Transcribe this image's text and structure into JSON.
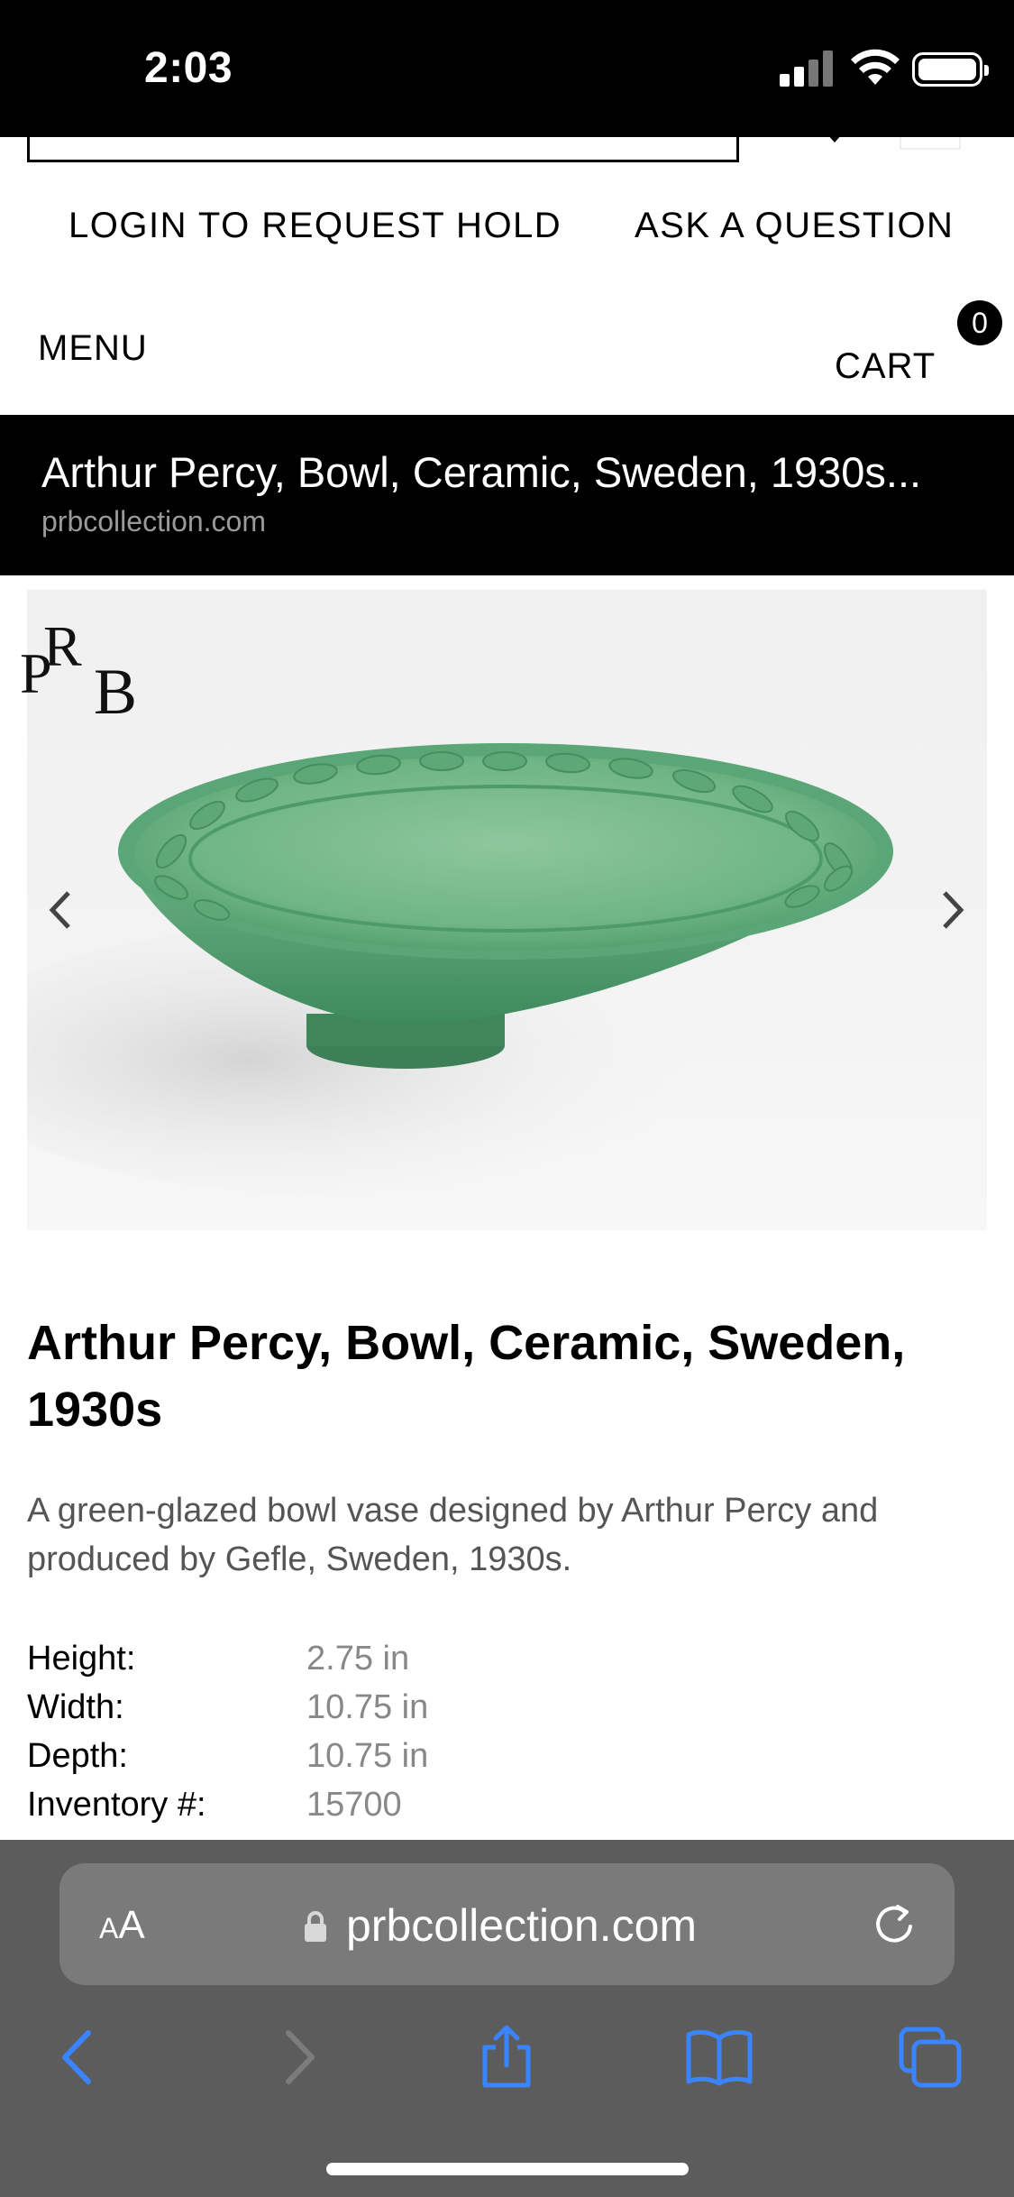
{
  "status_bar": {
    "time": "2:03"
  },
  "header": {
    "login_link": "LOGIN TO REQUEST HOLD",
    "ask_link": "ASK A QUESTION",
    "menu_label": "MENU",
    "cart_label": "CART",
    "cart_count": "0"
  },
  "banner": {
    "title": "Arthur Percy, Bowl, Ceramic, Sweden, 1930s...",
    "domain": "prbcollection.com"
  },
  "gallery": {
    "logo_text": "PRB",
    "logo_letters": [
      "P",
      "R",
      "B"
    ],
    "prev_icon": "chevron-left-icon",
    "next_icon": "chevron-right-icon"
  },
  "product": {
    "title": "Arthur Percy, Bowl, Ceramic, Sweden, 1930s",
    "description": "A green-glazed bowl vase designed by Arthur Percy and produced by Gefle, Sweden, 1930s.",
    "specs": [
      {
        "label": "Height:",
        "value": "2.75 in"
      },
      {
        "label": "Width:",
        "value": "10.75 in"
      },
      {
        "label": "Depth:",
        "value": "10.75 in"
      },
      {
        "label": "Inventory #:",
        "value": "15700"
      }
    ]
  },
  "browser": {
    "aa_label_small": "A",
    "aa_label_big": "A",
    "url": "prbcollection.com",
    "accent_color": "#3a84ff",
    "toolbar_icons": [
      "back-icon",
      "forward-icon",
      "share-icon",
      "bookmarks-icon",
      "tabs-icon"
    ]
  }
}
